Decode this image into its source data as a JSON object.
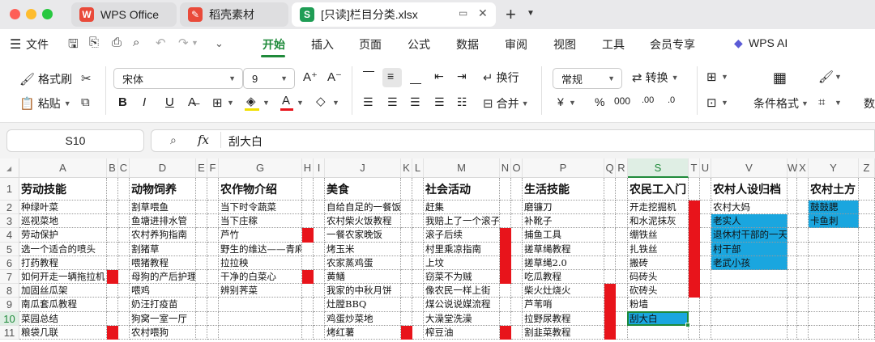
{
  "titlebar": {
    "tabs": [
      {
        "label": "WPS Office"
      },
      {
        "label": "稻壳素材"
      },
      {
        "label": "[只读]栏目分类.xlsx"
      }
    ],
    "new_tab": "+"
  },
  "menubar": {
    "file_label": "文件",
    "tabs": [
      "开始",
      "插入",
      "页面",
      "公式",
      "数据",
      "审阅",
      "视图",
      "工具",
      "会员专享"
    ],
    "ai_label": "WPS AI"
  },
  "toolbar": {
    "format_painter": "格式刷",
    "paste": "粘贴",
    "font_name": "宋体",
    "font_size": "9",
    "wrap": "换行",
    "merge": "合并",
    "number_format": "常规",
    "convert": "转换",
    "cond_format": "条件格式",
    "more": "数"
  },
  "formulabar": {
    "cell_ref": "S10",
    "fx": "fx",
    "content": "刮大白"
  },
  "grid": {
    "column_letters": [
      "A",
      "B",
      "C",
      "D",
      "E",
      "F",
      "G",
      "H",
      "I",
      "J",
      "K",
      "L",
      "M",
      "N",
      "O",
      "P",
      "Q",
      "R",
      "S",
      "T",
      "U",
      "V",
      "W",
      "X",
      "Y",
      "Z"
    ],
    "row_numbers": [
      "1",
      "2",
      "3",
      "4",
      "5",
      "6",
      "7",
      "8",
      "9",
      "10",
      "11"
    ],
    "selected_cell": "S10",
    "columns": {
      "A": [
        "劳动技能",
        "种绿叶菜",
        "巡视菜地",
        "劳动保护",
        "选一个适合的喷头",
        "打药教程",
        "如何开走一辆拖拉机",
        "加固丝瓜架",
        "南瓜套瓜教程",
        "菜园总结",
        "粮袋几联"
      ],
      "D": [
        "动物饲养",
        "割草喂鱼",
        "鱼塘进排水管",
        "农村养狗指南",
        "割猪草",
        "喂猪教程",
        "母狗的产后护理",
        "喂鸡",
        "奶汪打疫苗",
        "狗窝一室一厅",
        "农村喂狗"
      ],
      "G": [
        "农作物介绍",
        "当下时令蔬菜",
        "当下庄稼",
        "芦竹",
        "野生的维达——青麻",
        "拉拉秧",
        "干净的白菜心",
        "辨别荠菜",
        "",
        "",
        ""
      ],
      "J": [
        "美食",
        "自给自足的一餐饭",
        "农村柴火饭教程",
        "一餐农家晚饭",
        "烤玉米",
        "农家蒸鸡蛋",
        "黄鳝",
        "我家的中秋月饼",
        "灶膛BBQ",
        "鸡蛋炒菜地",
        "烤红薯"
      ],
      "M": [
        "社会活动",
        "赶集",
        "我赔上了一个滚子",
        "滚子后续",
        "村里乘凉指南",
        "上坟",
        "窃菜不为贼",
        "像农民一样上街",
        "煤公说说媒流程",
        "大澡堂洗澡",
        "榨豆油"
      ],
      "P": [
        "生活技能",
        "磨镰刀",
        "补靴子",
        "捕鱼工具",
        "搓草绳教程",
        "搓草绳2.0",
        "吃瓜教程",
        "柴火灶烧火",
        "芦苇哨",
        "拉野尿教程",
        "割韭菜教程"
      ],
      "S": [
        "农民工入门",
        "开走挖掘机",
        "和水泥抹灰",
        "绷铁丝",
        "扎铁丝",
        "搬砖",
        "码砖头",
        "砍砖头",
        "粉墙",
        "刮大白",
        ""
      ],
      "V": [
        "农村人设归档",
        "农村大妈",
        "老实人",
        "退休村干部的一天",
        "村干部",
        "老武小孩",
        "",
        "",
        "",
        "",
        ""
      ],
      "Y": [
        "农村土方",
        "鼓鼓腮",
        "卡鱼刺",
        "",
        "",
        "",
        "",
        "",
        "",
        "",
        ""
      ]
    },
    "blue_cells": [
      "V3",
      "V4",
      "V5",
      "V6",
      "Y2",
      "Y3",
      "S10"
    ],
    "red_markers": [
      "B7",
      "B11",
      "H4",
      "H7",
      "K11",
      "N4",
      "N5",
      "N6",
      "N7",
      "N11",
      "Q8",
      "Q9",
      "Q10",
      "Q11",
      "T2",
      "T3",
      "T4",
      "T5",
      "T6",
      "T7",
      "T8"
    ],
    "fill_colors": {
      "blue": "#1aa6df",
      "red": "#e8141b",
      "accent": "#1f8a3a"
    }
  }
}
